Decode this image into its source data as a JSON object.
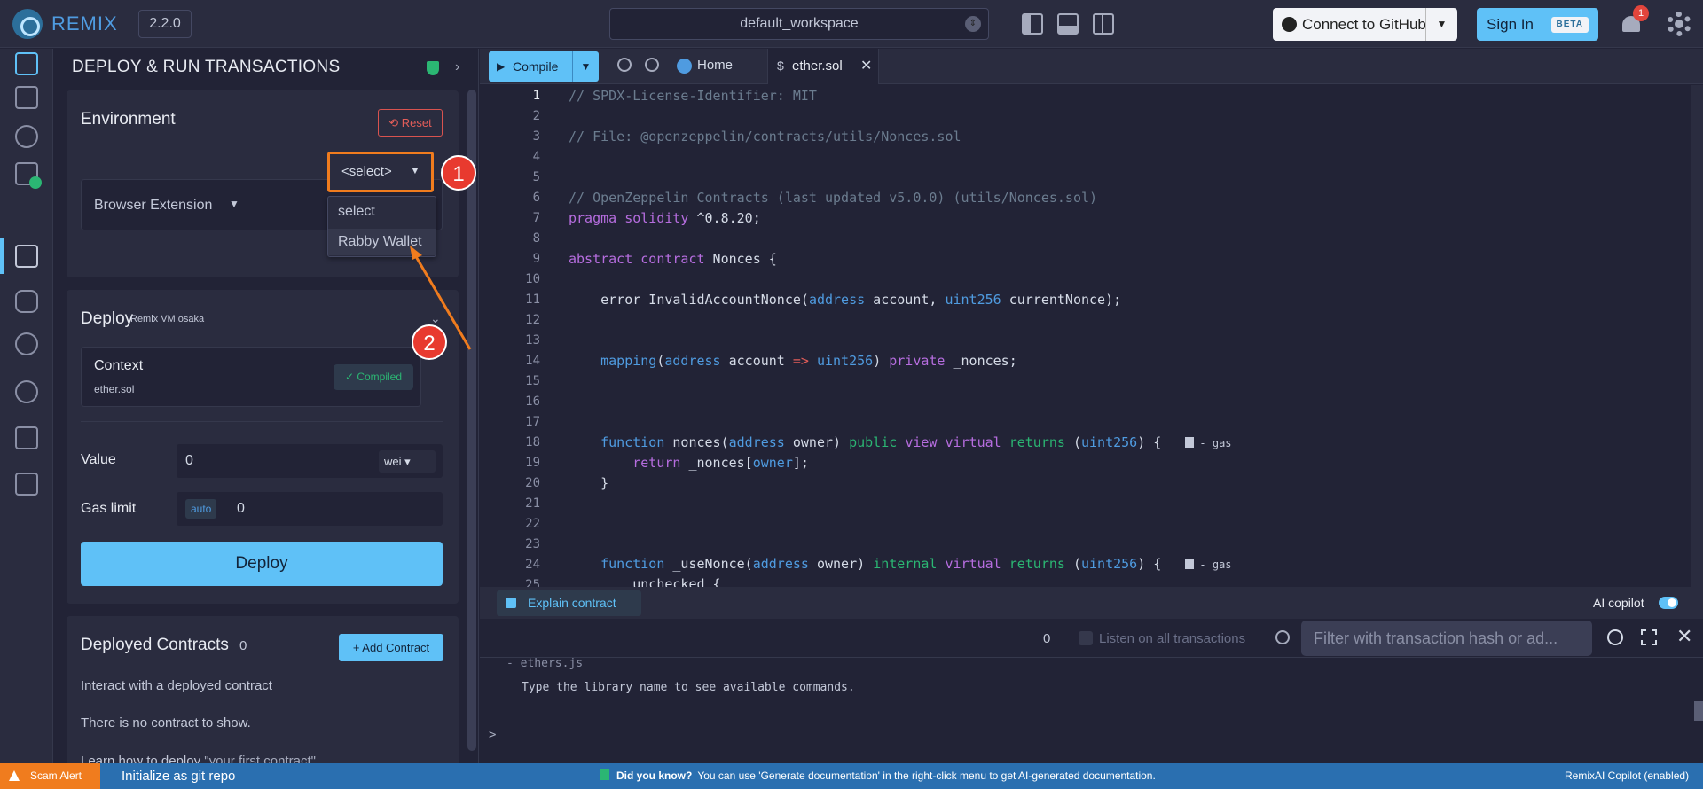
{
  "topbar": {
    "brand": "REMIX",
    "version": "2.2.0",
    "workspace": "default_workspace",
    "github_label": "Connect to GitHub",
    "signin_label": "Sign In",
    "beta_label": "BETA",
    "notification_count": "1"
  },
  "panel": {
    "title": "DEPLOY & RUN TRANSACTIONS",
    "environment": {
      "heading": "Environment",
      "reset_label": "Reset",
      "env_value": "Browser Extension",
      "select_value": "<select>",
      "dropdown_options": [
        "select",
        "Rabby Wallet"
      ]
    },
    "deploy": {
      "heading": "Deploy",
      "subheading": "Remix VM osaka",
      "context_label": "Context",
      "context_file": "ether.sol",
      "compiled_label": "Compiled",
      "value_label": "Value",
      "value": "0",
      "unit": "wei",
      "gas_label": "Gas limit",
      "gas_auto": "auto",
      "gas_value": "0",
      "deploy_button": "Deploy"
    },
    "deployed": {
      "heading": "Deployed Contracts",
      "count": "0",
      "add_label": "+ Add Contract",
      "line1": "Interact with a deployed contract",
      "line2": "There is no contract to show.",
      "line3_prefix": "Learn how to deploy ",
      "line3_link": "\"your first contract\"."
    }
  },
  "annotations": {
    "step1": "1",
    "step2": "2"
  },
  "tabs": {
    "compile_label": "Compile",
    "home_label": "Home",
    "file_label": "ether.sol"
  },
  "editor": {
    "line_numbers": [
      "1",
      "2",
      "3",
      "4",
      "5",
      "6",
      "7",
      "8",
      "9",
      "10",
      "11",
      "12",
      "13",
      "14",
      "15",
      "16",
      "17",
      "18",
      "19",
      "20",
      "21",
      "22",
      "23",
      "24",
      "25"
    ],
    "gas_hint": "- gas"
  },
  "terminal": {
    "explain_label": "Explain contract",
    "copilot_label": "AI copilot",
    "tx_count": "0",
    "listen_label": "Listen on all transactions",
    "filter_placeholder": "Filter with transaction hash or ad...",
    "line_lib": "- ethers.js",
    "line_hint": "Type the library name to see available commands.",
    "prompt": ">"
  },
  "statusbar": {
    "scam_label": "Scam Alert",
    "git_label": "Initialize as git repo",
    "dyk_title": "Did you know?",
    "dyk_text": "You can use 'Generate documentation' in the right-click menu to get AI-generated documentation.",
    "remixai_label": "RemixAI Copilot (enabled)"
  },
  "colors": {
    "accent": "#5fc1f7",
    "background": "#222336",
    "panel": "#2a2c3f",
    "annotation_orange": "#f07c1e",
    "annotation_red": "#e83a2f",
    "status_blue": "#2a6fb0"
  }
}
